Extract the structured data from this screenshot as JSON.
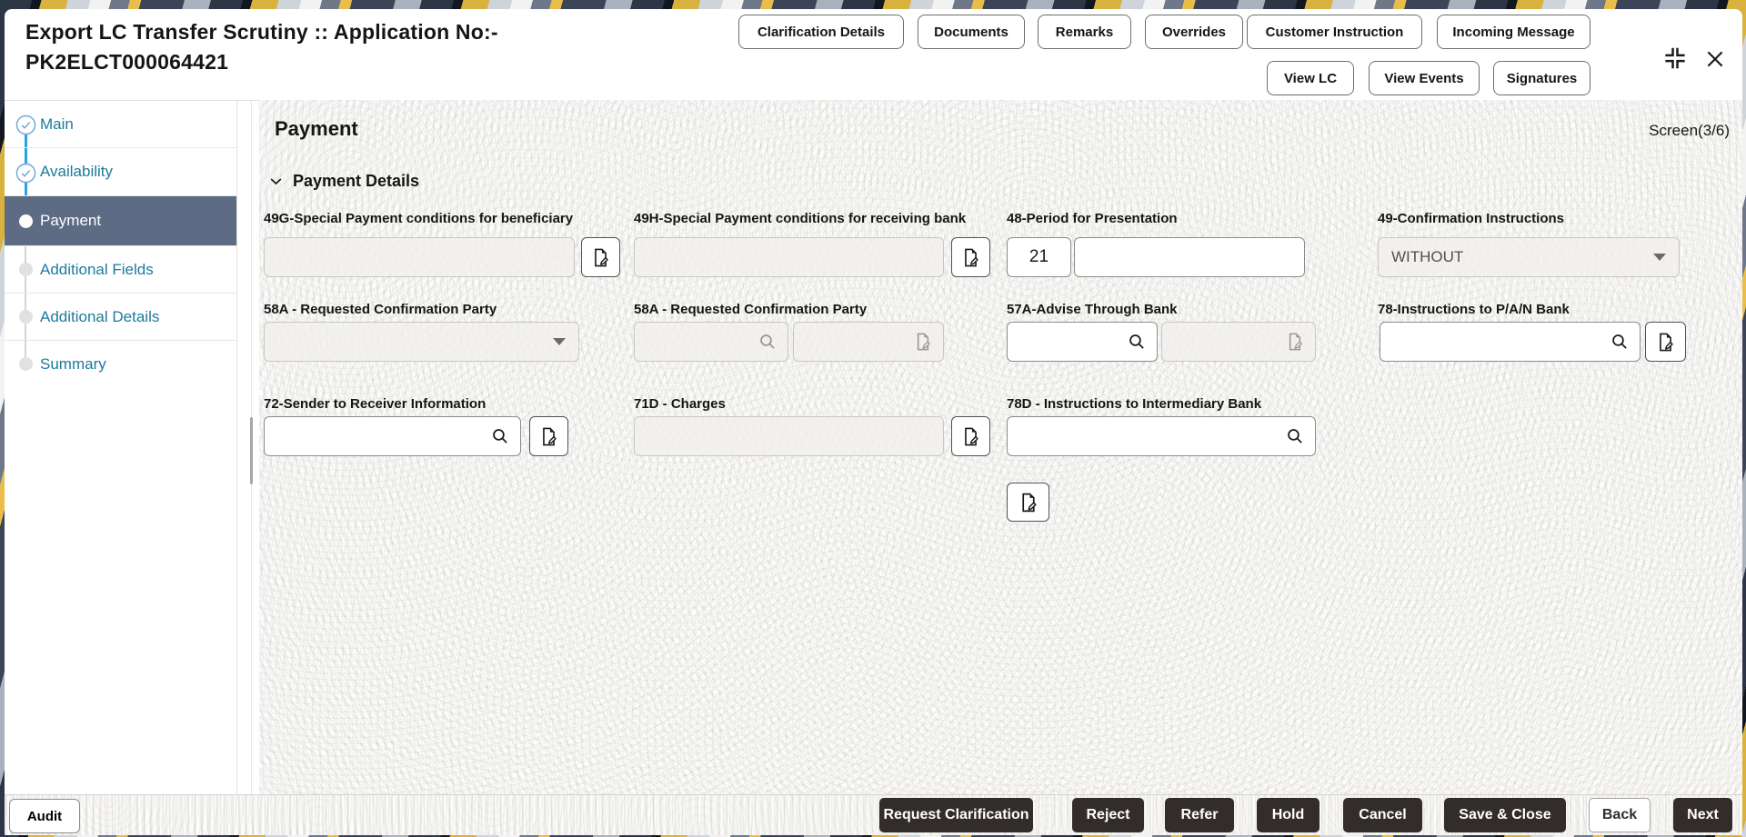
{
  "header": {
    "title_line1": "Export LC Transfer Scrutiny :: Application No:-",
    "title_line2": "PK2ELCT000064421",
    "actions_row1": [
      "Clarification Details",
      "Documents",
      "Remarks",
      "Overrides",
      "Customer Instruction",
      "Incoming Message"
    ],
    "actions_row2": [
      "View LC",
      "View Events",
      "Signatures"
    ],
    "window_icons": [
      "collapse-icon",
      "close-icon"
    ]
  },
  "sidebar": {
    "items": [
      {
        "label": "Main",
        "state": "completed"
      },
      {
        "label": "Availability",
        "state": "completed"
      },
      {
        "label": "Payment",
        "state": "active"
      },
      {
        "label": "Additional Fields",
        "state": "upcoming"
      },
      {
        "label": "Additional Details",
        "state": "upcoming"
      },
      {
        "label": "Summary",
        "state": "upcoming"
      }
    ]
  },
  "main": {
    "title": "Payment",
    "screen_indicator": "Screen(3/6)",
    "section_title": "Payment Details"
  },
  "fields": {
    "f49g": {
      "label": "49G-Special Payment conditions for beneficiary",
      "value": ""
    },
    "f49h": {
      "label": "49H-Special Payment conditions for receiving bank",
      "value": ""
    },
    "f48": {
      "label": "48-Period for Presentation",
      "days_value": "21",
      "text_value": ""
    },
    "f49": {
      "label": "49-Confirmation Instructions",
      "value": "WITHOUT"
    },
    "f58a_dd": {
      "label": "58A - Requested Confirmation Party",
      "value": ""
    },
    "f58a_party": {
      "label": "58A - Requested Confirmation Party",
      "value": ""
    },
    "f57a": {
      "label": "57A-Advise Through Bank",
      "value": ""
    },
    "f78": {
      "label": "78-Instructions to P/A/N Bank",
      "value": ""
    },
    "f72": {
      "label": "72-Sender to Receiver Information",
      "value": ""
    },
    "f71d": {
      "label": "71D - Charges",
      "value": ""
    },
    "f78d": {
      "label": "78D - Instructions to Intermediary Bank",
      "value": ""
    }
  },
  "footer": {
    "audit_label": "Audit",
    "buttons": [
      {
        "label": "Request Clarification",
        "style": "dark"
      },
      {
        "label": "Reject",
        "style": "dark"
      },
      {
        "label": "Refer",
        "style": "dark"
      },
      {
        "label": "Hold",
        "style": "dark"
      },
      {
        "label": "Cancel",
        "style": "dark"
      },
      {
        "label": "Save & Close",
        "style": "dark"
      },
      {
        "label": "Back",
        "style": "light"
      },
      {
        "label": "Next",
        "style": "dark"
      }
    ]
  },
  "icons": {
    "search": "search-icon",
    "edit": "file-edit-icon",
    "chevron": "chevron-down-icon",
    "caret": "caret-down-icon",
    "check": "check-circle-icon",
    "collapse": "collapse-icon",
    "close": "close-icon"
  },
  "colors": {
    "accent_blue": "#1d7a9e",
    "active_step_bg": "#5d6b84",
    "connector_blue": "#2aa4db",
    "completed_check": "#74a9da",
    "dark_button": "#322d2a",
    "strip_yellow": "#d9b13f",
    "strip_navy": "#2c3647"
  }
}
